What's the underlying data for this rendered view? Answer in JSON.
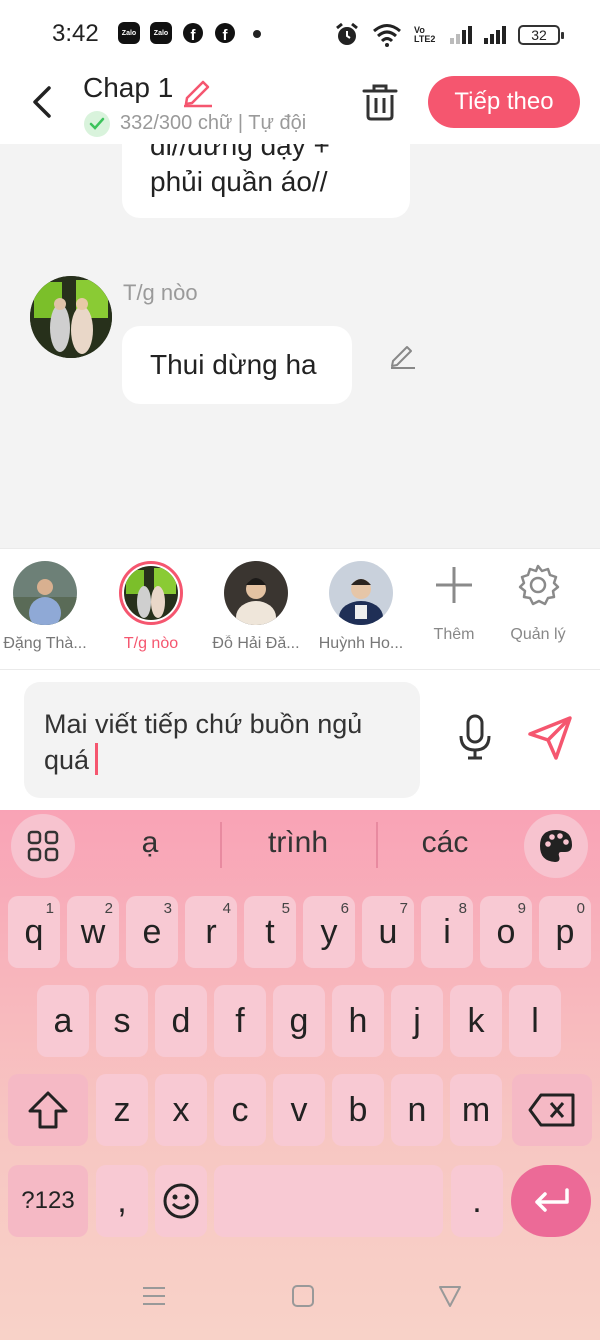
{
  "status_bar": {
    "time": "3:42",
    "apps": [
      "Zalo",
      "Zalo",
      "f",
      "f"
    ],
    "network": "Vo LTE2",
    "battery": "32",
    "icons": [
      "alarm-icon",
      "wifi-icon",
      "signal-icon",
      "battery-icon"
    ]
  },
  "header": {
    "title": "Chap 1",
    "subtitle": "332/300 chữ | Tự đội",
    "next_label": "Tiếp theo",
    "icons": [
      "back-arrow-icon",
      "edit-pencil-icon",
      "check-icon",
      "trash-icon"
    ]
  },
  "messages": [
    {
      "lines": [
        "di//dừng dậy +",
        "phủi quần áo//"
      ]
    },
    {
      "sender": "T/g nòo",
      "text": "Thui dừng ha"
    }
  ],
  "characters": [
    {
      "name": "Đặng Thà..."
    },
    {
      "name": "T/g nòo",
      "selected": true
    },
    {
      "name": "Đỗ Hải Đă..."
    },
    {
      "name": "Huỳnh Ho..."
    }
  ],
  "tools": {
    "add_label": "Thêm",
    "manage_label": "Quản lý"
  },
  "composer": {
    "text": "Mai viết tiếp chứ buồn ngủ quá"
  },
  "keyboard": {
    "suggestions": [
      "ạ",
      "trình",
      "các"
    ],
    "row1": [
      "q",
      "w",
      "e",
      "r",
      "t",
      "y",
      "u",
      "i",
      "o",
      "p"
    ],
    "row1_nums": [
      "1",
      "2",
      "3",
      "4",
      "5",
      "6",
      "7",
      "8",
      "9",
      "0"
    ],
    "row2": [
      "a",
      "s",
      "d",
      "f",
      "g",
      "h",
      "j",
      "k",
      "l"
    ],
    "row3": [
      "z",
      "x",
      "c",
      "v",
      "b",
      "n",
      "m"
    ],
    "symbols_label": "?123",
    "comma": ",",
    "period": "."
  },
  "colors": {
    "accent": "#f5566f",
    "keyboard_top": "#f9a3b6",
    "enter_key": "#ec6a97"
  }
}
